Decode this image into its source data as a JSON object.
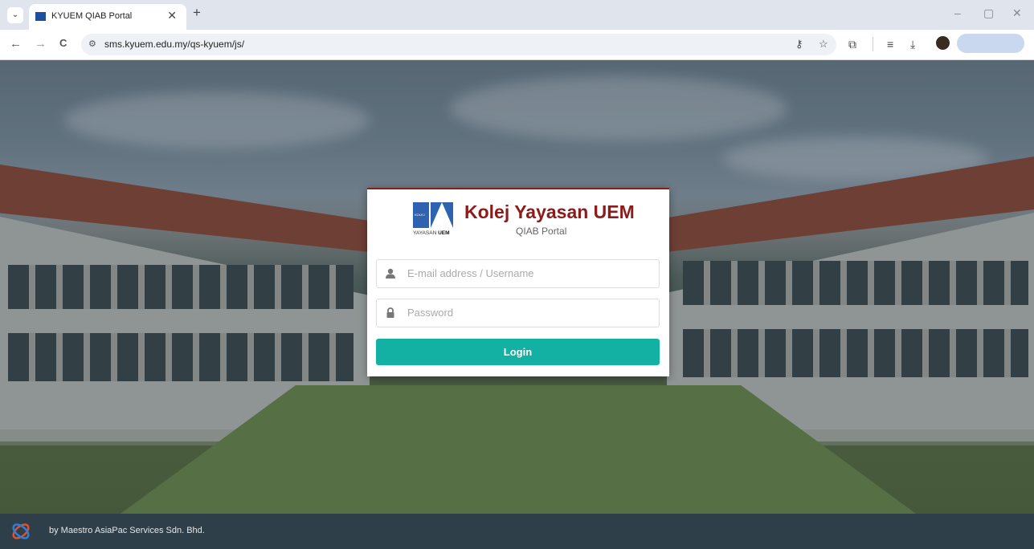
{
  "browser": {
    "tab_title": "KYUEM QIAB Portal",
    "tab_close": "✕",
    "new_tab": "+",
    "url": "sms.kyuem.edu.my/qs-kyuem/js/",
    "nav_back": "←",
    "nav_forward": "→",
    "nav_reload": "C",
    "window_controls": [
      "–",
      "▢",
      "✕"
    ]
  },
  "login": {
    "brand_title": "Kolej Yayasan UEM",
    "brand_subtitle": "QIAB Portal",
    "logo_small": "KOLEJ",
    "logo_text_prefix": "YAYASAN ",
    "logo_text_bold": "UEM",
    "username_placeholder": "E-mail address / Username",
    "password_placeholder": "Password",
    "login_label": "Login"
  },
  "footer": {
    "credit": "by Maestro AsiaPac Services Sdn. Bhd."
  },
  "colors": {
    "brand_red": "#8a1c1c",
    "button_teal": "#13b1a3",
    "footer_bg": "#2e3f4a"
  }
}
